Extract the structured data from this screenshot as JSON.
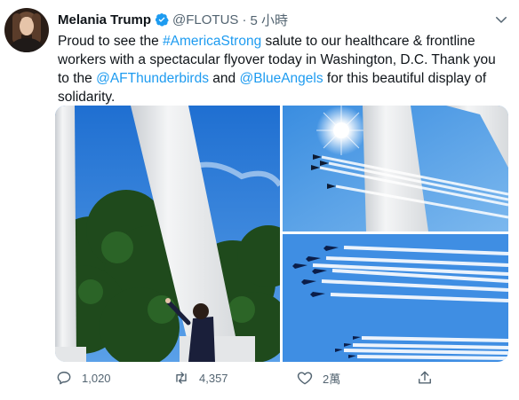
{
  "tweet": {
    "display_name": "Melania Trump",
    "handle": "@FLOTUS",
    "separator": "·",
    "time": "5 小時",
    "text": {
      "t1": "Proud to see the ",
      "hashtag": "#AmericaStrong",
      "t2": " salute to our healthcare & frontline workers with a spectacular flyover today in Washington, D.C.  Thank you to the ",
      "mention1": "@AFThunderbirds",
      "t3": " and ",
      "mention2": "@BlueAngels",
      "t4": " for this beautiful display of solidarity."
    }
  },
  "actions": {
    "reply_count": "1,020",
    "retweet_count": "4,357",
    "like_count": "2萬",
    "share_label": ""
  },
  "icons": {
    "verified": "verified-badge-icon",
    "menu": "chevron-down-icon",
    "reply": "reply-icon",
    "retweet": "retweet-icon",
    "like": "heart-icon",
    "share": "share-icon"
  },
  "colors": {
    "link": "#1d9bf0",
    "muted": "#536471",
    "sky": "#2f7fd3"
  }
}
